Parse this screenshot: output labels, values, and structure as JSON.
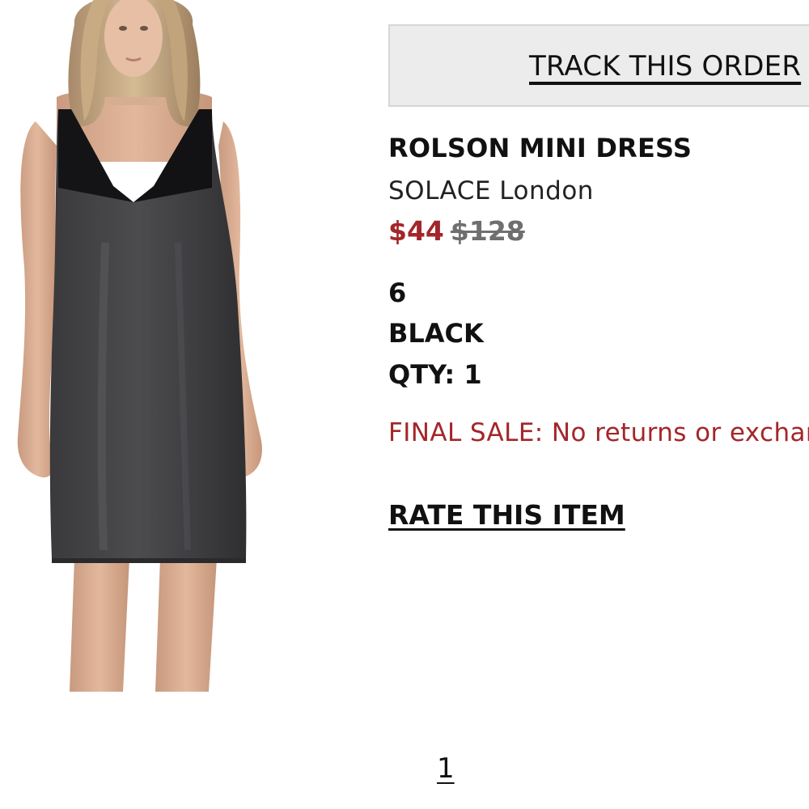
{
  "order": {
    "track_label": "TRACK THIS ORDER"
  },
  "product": {
    "name": "ROLSON MINI DRESS",
    "brand": "SOLACE London",
    "sale_price": "$44",
    "original_price": "$128",
    "size": "6",
    "color": "BLACK",
    "quantity": "QTY: 1",
    "final_sale_notice": "FINAL SALE: No returns or exchanges.",
    "rate_label": "RATE THIS ITEM",
    "image_icon": "product-photo-black-dress"
  },
  "pagination": {
    "current_page": "1"
  },
  "colors": {
    "sale": "#a3262a",
    "original_price": "#6f6f6f",
    "button_bg": "#ececec",
    "text": "#111111"
  }
}
